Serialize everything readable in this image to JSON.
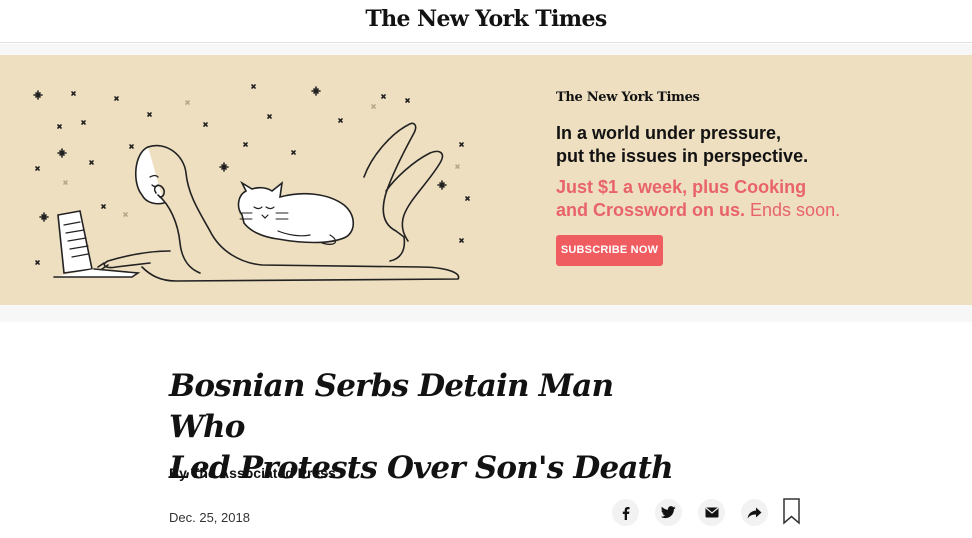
{
  "masthead": {
    "logo": "The New York Times"
  },
  "promo": {
    "logo": "The New York Times",
    "headline_line1": "In a world under pressure,",
    "headline_line2": "put the issues in perspective.",
    "offer_bold_line1": "Just $1 a week, plus Cooking",
    "offer_bold_line2": "and Crossword on us.",
    "offer_suffix": " Ends soon.",
    "button": "SUBSCRIBE NOW",
    "colors": {
      "background": "#eedfc1",
      "accent": "#f05d61",
      "offer_text": "#e8636a"
    }
  },
  "article": {
    "title_line1": "Bosnian Serbs Detain Man Who",
    "title_line2": "Led Protests Over Son's Death",
    "byline": "By The Associated Press",
    "date": "Dec. 25, 2018"
  },
  "share": {
    "icons": [
      "facebook-icon",
      "twitter-icon",
      "email-icon",
      "share-arrow-icon",
      "bookmark-icon"
    ]
  }
}
